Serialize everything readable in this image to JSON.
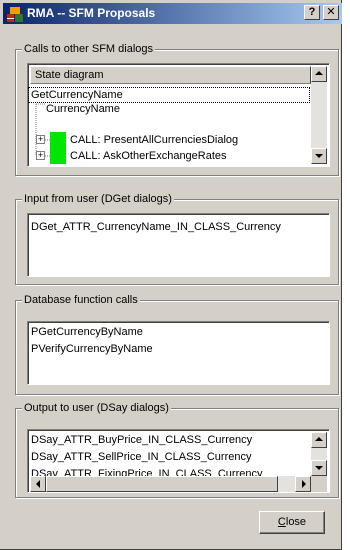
{
  "window": {
    "title": "RMA -- SFM Proposals",
    "help_button": "?",
    "close_button": "✕"
  },
  "calls_group": {
    "legend": "Calls to other SFM dialogs",
    "column_header": "State diagram",
    "tree": [
      "GetCurrencyName",
      "CurrencyName",
      "CALL: PresentAllCurrenciesDialog",
      "CALL: AskOtherExchangeRates"
    ],
    "status_color": "#00e600"
  },
  "input_group": {
    "legend": "Input from user (DGet dialogs)",
    "items": [
      "DGet_ATTR_CurrencyName_IN_CLASS_Currency"
    ]
  },
  "db_group": {
    "legend": "Database function calls",
    "items": [
      "PGetCurrencyByName",
      "PVerifyCurrencyByName"
    ]
  },
  "output_group": {
    "legend": "Output to user (DSay dialogs)",
    "items": [
      "DSay_ATTR_BuyPrice_IN_CLASS_Currency",
      "DSay_ATTR_SellPrice_IN_CLASS_Currency",
      "DSay_ATTR_FixingPrice_IN_CLASS_Currency"
    ]
  },
  "close_button": {
    "mnemonic": "C",
    "rest": "lose"
  }
}
